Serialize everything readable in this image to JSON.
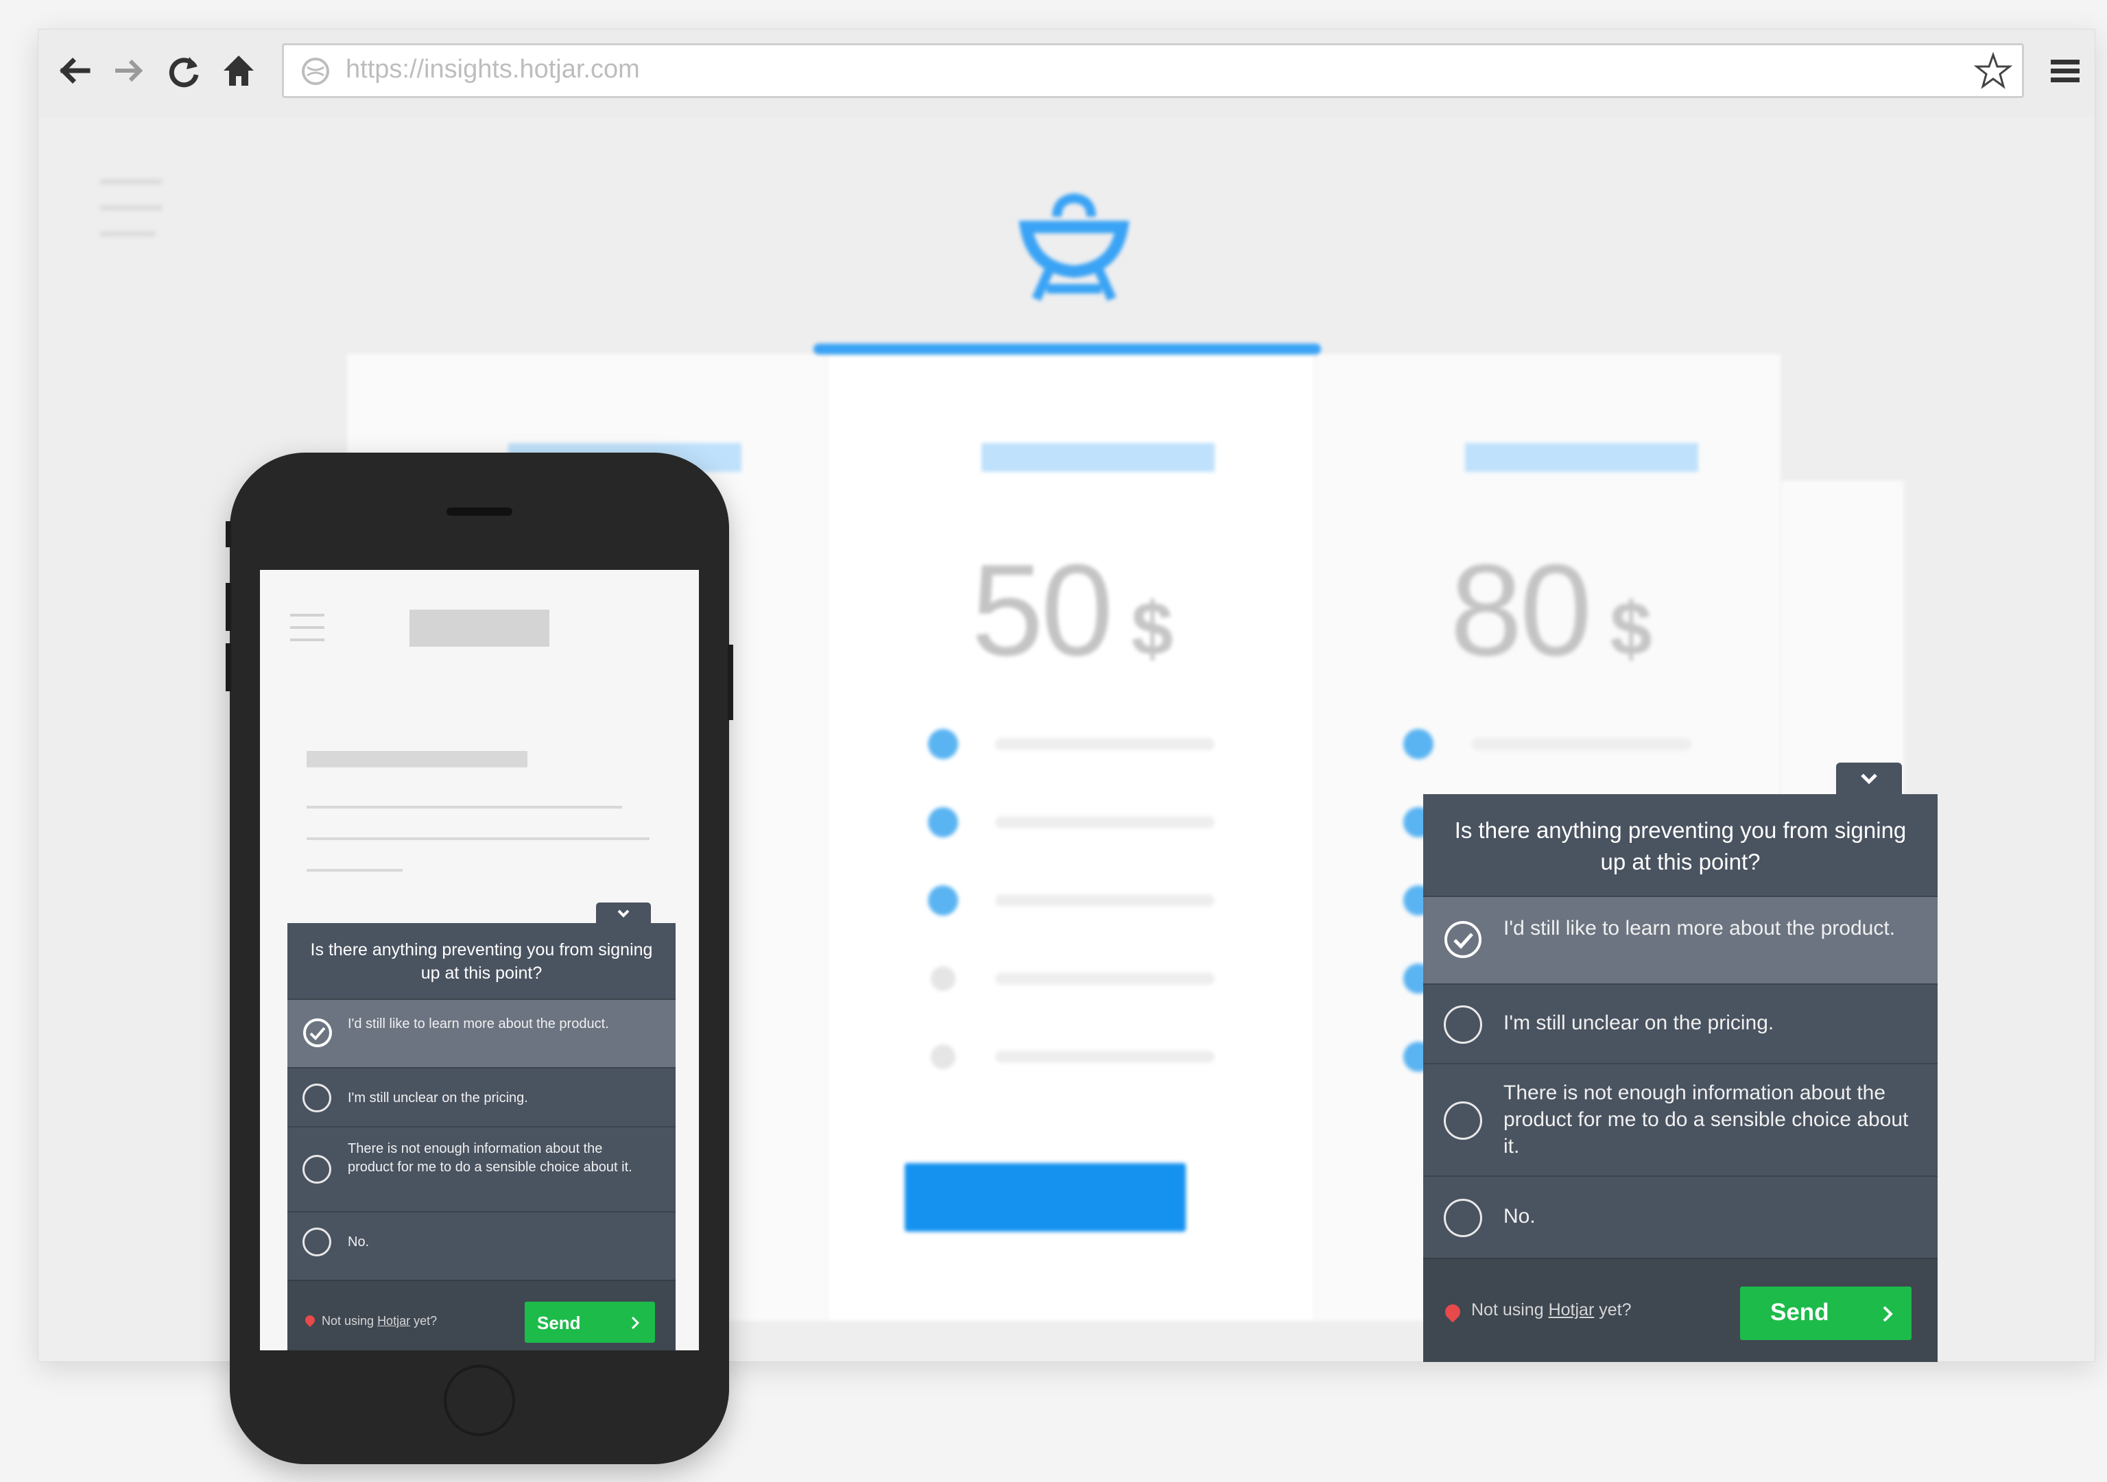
{
  "browser": {
    "url": "https://insights.hotjar.com",
    "icons": [
      "back-arrow-icon",
      "forward-arrow-icon",
      "reload-icon",
      "home-icon",
      "globe-icon",
      "star-icon",
      "menu-icon"
    ]
  },
  "site": {
    "logo_icon": "grill-icon",
    "plans": [
      {
        "price": "50",
        "currency": "$"
      },
      {
        "price": "80",
        "currency": "$"
      }
    ]
  },
  "survey": {
    "question": "Is there anything preventing you from signing up at this point?",
    "options": [
      {
        "label": "I'd still like to learn more about the product.",
        "selected": true
      },
      {
        "label": "I'm still unclear on the pricing.",
        "selected": false
      },
      {
        "label": "There is not enough information about the product for me to do a sensible choice about it.",
        "selected": false
      },
      {
        "label": "No.",
        "selected": false
      }
    ],
    "footer_prefix": "Not using",
    "footer_link": "Hotjar",
    "footer_suffix": "yet?",
    "send_label": "Send",
    "colors": {
      "panel": "#4a5360",
      "selected": "#6b7480",
      "send": "#1dbb4a",
      "accent": "#3aa3f5"
    }
  }
}
